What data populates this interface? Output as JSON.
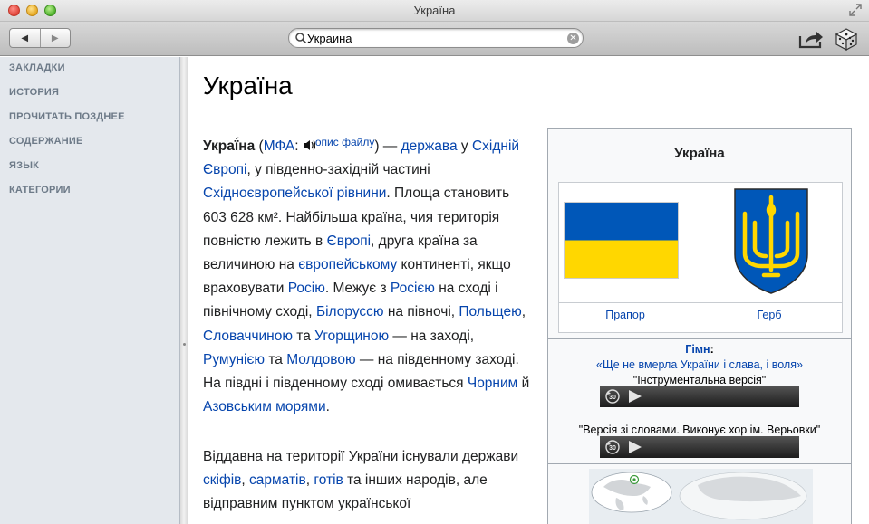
{
  "window": {
    "title": "Україна"
  },
  "toolbar": {
    "back_label": "◀",
    "forward_label": "▶",
    "search": {
      "value": "Украина"
    }
  },
  "sidebar": {
    "items": [
      {
        "label": "ЗАКЛАДКИ"
      },
      {
        "label": "ИСТОРИЯ"
      },
      {
        "label": "ПРОЧИТАТЬ ПОЗДНЕЕ"
      },
      {
        "label": "СОДЕРЖАНИЕ"
      },
      {
        "label": "ЯЗЫК"
      },
      {
        "label": "КАТЕГОРИИ"
      }
    ]
  },
  "article": {
    "title": "Україна",
    "p1": {
      "bold": "Украї́на",
      "t0": " (",
      "l_mfa": "МФА",
      "t1": ": ",
      "l_file": "опис файлу",
      "t2": ") — ",
      "l_state": "держава",
      "t3": " у ",
      "l_east_europe": "Східній Європі",
      "t4": ", у південно-західній частині ",
      "l_plain": "Східноєвропейської рівнини",
      "t5": ". Площа становить 603 628 км². Найбільша країна, чия територія повністю лежить в ",
      "l_europe": "Європі",
      "t6": ", друга країна за величиною на ",
      "l_continent": "європейському",
      "t7": " континенті, якщо враховувати ",
      "l_russia1": "Росію",
      "t8": ". Межує з ",
      "l_russia2": "Росією",
      "t9": " на сході і північному сході, ",
      "l_belarus": "Білоруссю",
      "t10": " на півночі, ",
      "l_poland": "Польщею",
      "t11": ", ",
      "l_slovakia": "Словаччиною",
      "t12": " та ",
      "l_hungary": "Угорщиною",
      "t13": " — на заході, ",
      "l_romania": "Румунією",
      "t14": " та ",
      "l_moldova": "Молдовою",
      "t15": " — на південному заході. На півдні і південному сході омивається ",
      "l_black": "Чорним",
      "t16": " й ",
      "l_azov": "Азовським морями",
      "t17": "."
    },
    "p2": {
      "t0": "Віддавна на території України існували держави ",
      "l_scythians": "скіфів",
      "t1": ", ",
      "l_sarmatians": "сарматів",
      "t2": ", ",
      "l_goths": "готів",
      "t3": " та інших народів, але відправним пунктом української"
    }
  },
  "infobox": {
    "title": "Україна",
    "flag_label": "Прапор",
    "coat_label": "Герб",
    "anthem_label": "Гімн",
    "anthem_colon": ":",
    "anthem_name": "«Ще не вмерла України і слава, і воля»",
    "version1": "\"Інструментальна версія\"",
    "version2": "\"Версія зі словами. Виконує хор ім. Верьовки\"",
    "colors": {
      "flag_blue": "#0057b8",
      "flag_yellow": "#ffd700"
    }
  }
}
